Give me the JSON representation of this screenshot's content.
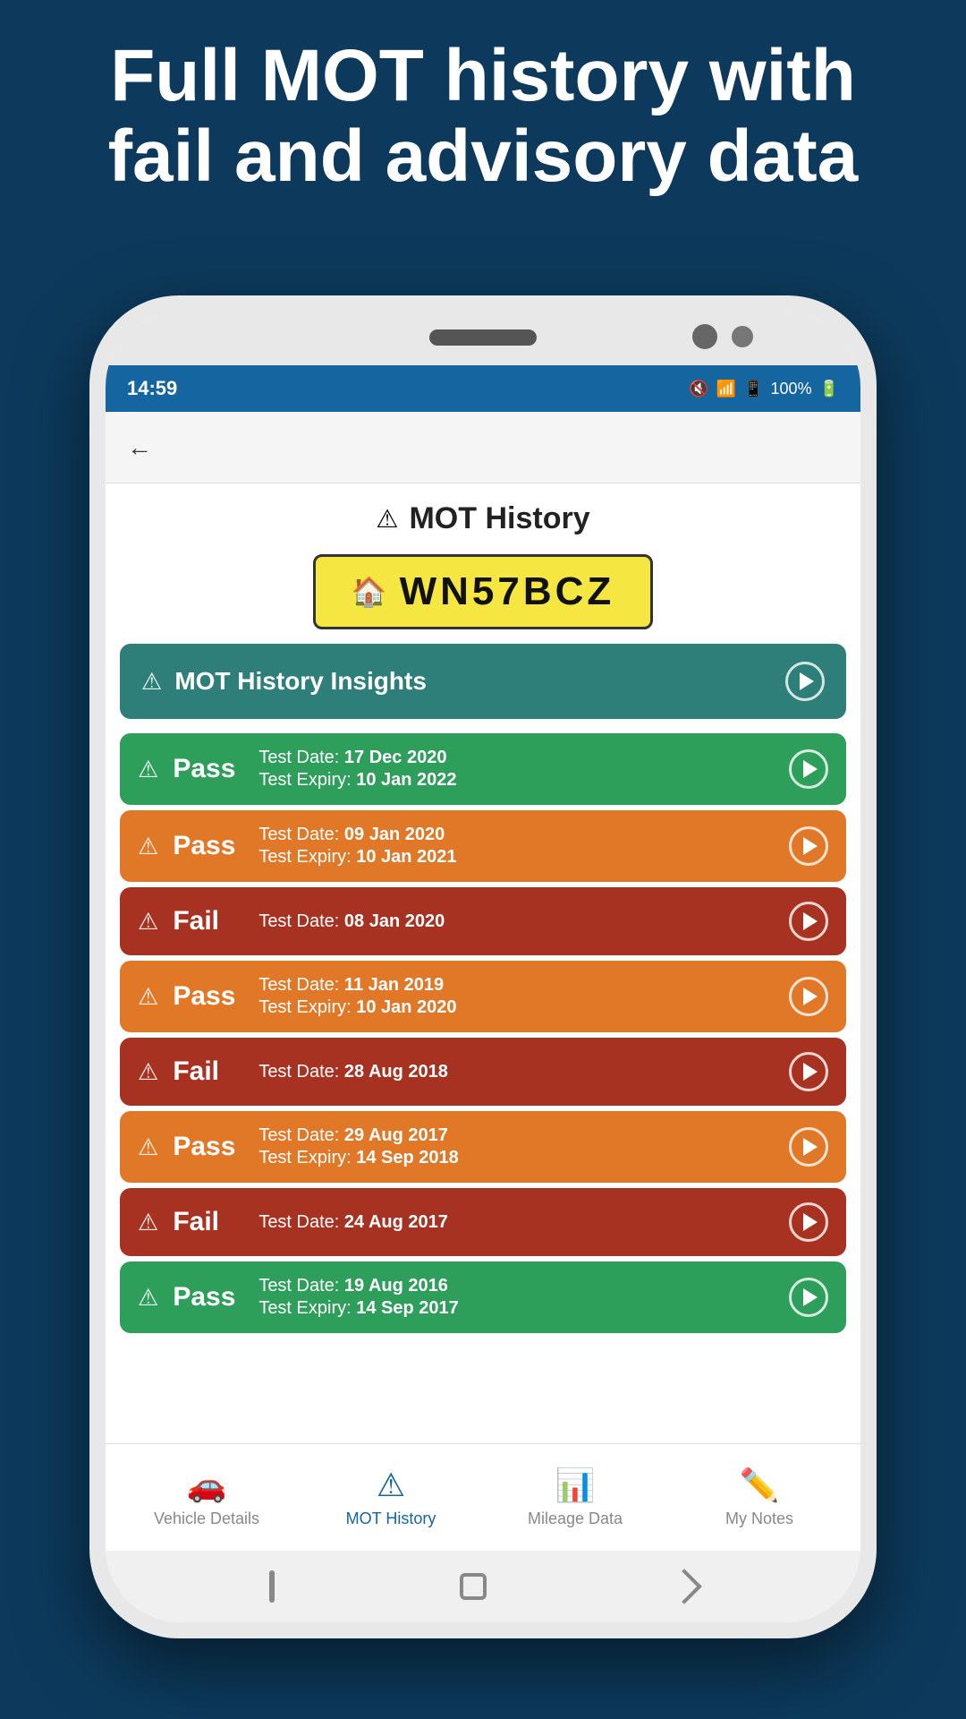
{
  "headline": "Full MOT history with fail and advisory data",
  "statusBar": {
    "time": "14:59",
    "battery": "100%"
  },
  "screen": {
    "title": "MOT History",
    "plate": "WN57BCZ",
    "insights": {
      "label": "MOT History Insights"
    },
    "motRecords": [
      {
        "result": "Pass",
        "colorClass": "pass-green",
        "testDate": "17 Dec 2020",
        "expiryDate": "10 Jan 2022",
        "hasExpiry": true
      },
      {
        "result": "Pass",
        "colorClass": "pass-orange",
        "testDate": "09 Jan 2020",
        "expiryDate": "10 Jan 2021",
        "hasExpiry": true
      },
      {
        "result": "Fail",
        "colorClass": "fail",
        "testDate": "08 Jan 2020",
        "expiryDate": null,
        "hasExpiry": false
      },
      {
        "result": "Pass",
        "colorClass": "pass-orange",
        "testDate": "11 Jan 2019",
        "expiryDate": "10 Jan 2020",
        "hasExpiry": true
      },
      {
        "result": "Fail",
        "colorClass": "fail",
        "testDate": "28 Aug 2018",
        "expiryDate": null,
        "hasExpiry": false
      },
      {
        "result": "Pass",
        "colorClass": "pass-orange",
        "testDate": "29 Aug 2017",
        "expiryDate": "14 Sep 2018",
        "hasExpiry": true
      },
      {
        "result": "Fail",
        "colorClass": "fail",
        "testDate": "24 Aug 2017",
        "expiryDate": null,
        "hasExpiry": false
      },
      {
        "result": "Pass",
        "colorClass": "pass-green",
        "testDate": "19 Aug 2016",
        "expiryDate": "14 Sep 2017",
        "hasExpiry": true
      }
    ],
    "bottomNav": [
      {
        "label": "Vehicle Details",
        "icon": "🚗",
        "active": false,
        "id": "vehicle-details"
      },
      {
        "label": "MOT History",
        "icon": "⚠",
        "active": true,
        "id": "mot-history"
      },
      {
        "label": "Mileage Data",
        "icon": "📊",
        "active": false,
        "id": "mileage-data"
      },
      {
        "label": "My Notes",
        "icon": "✏️",
        "active": false,
        "id": "my-notes"
      }
    ]
  }
}
